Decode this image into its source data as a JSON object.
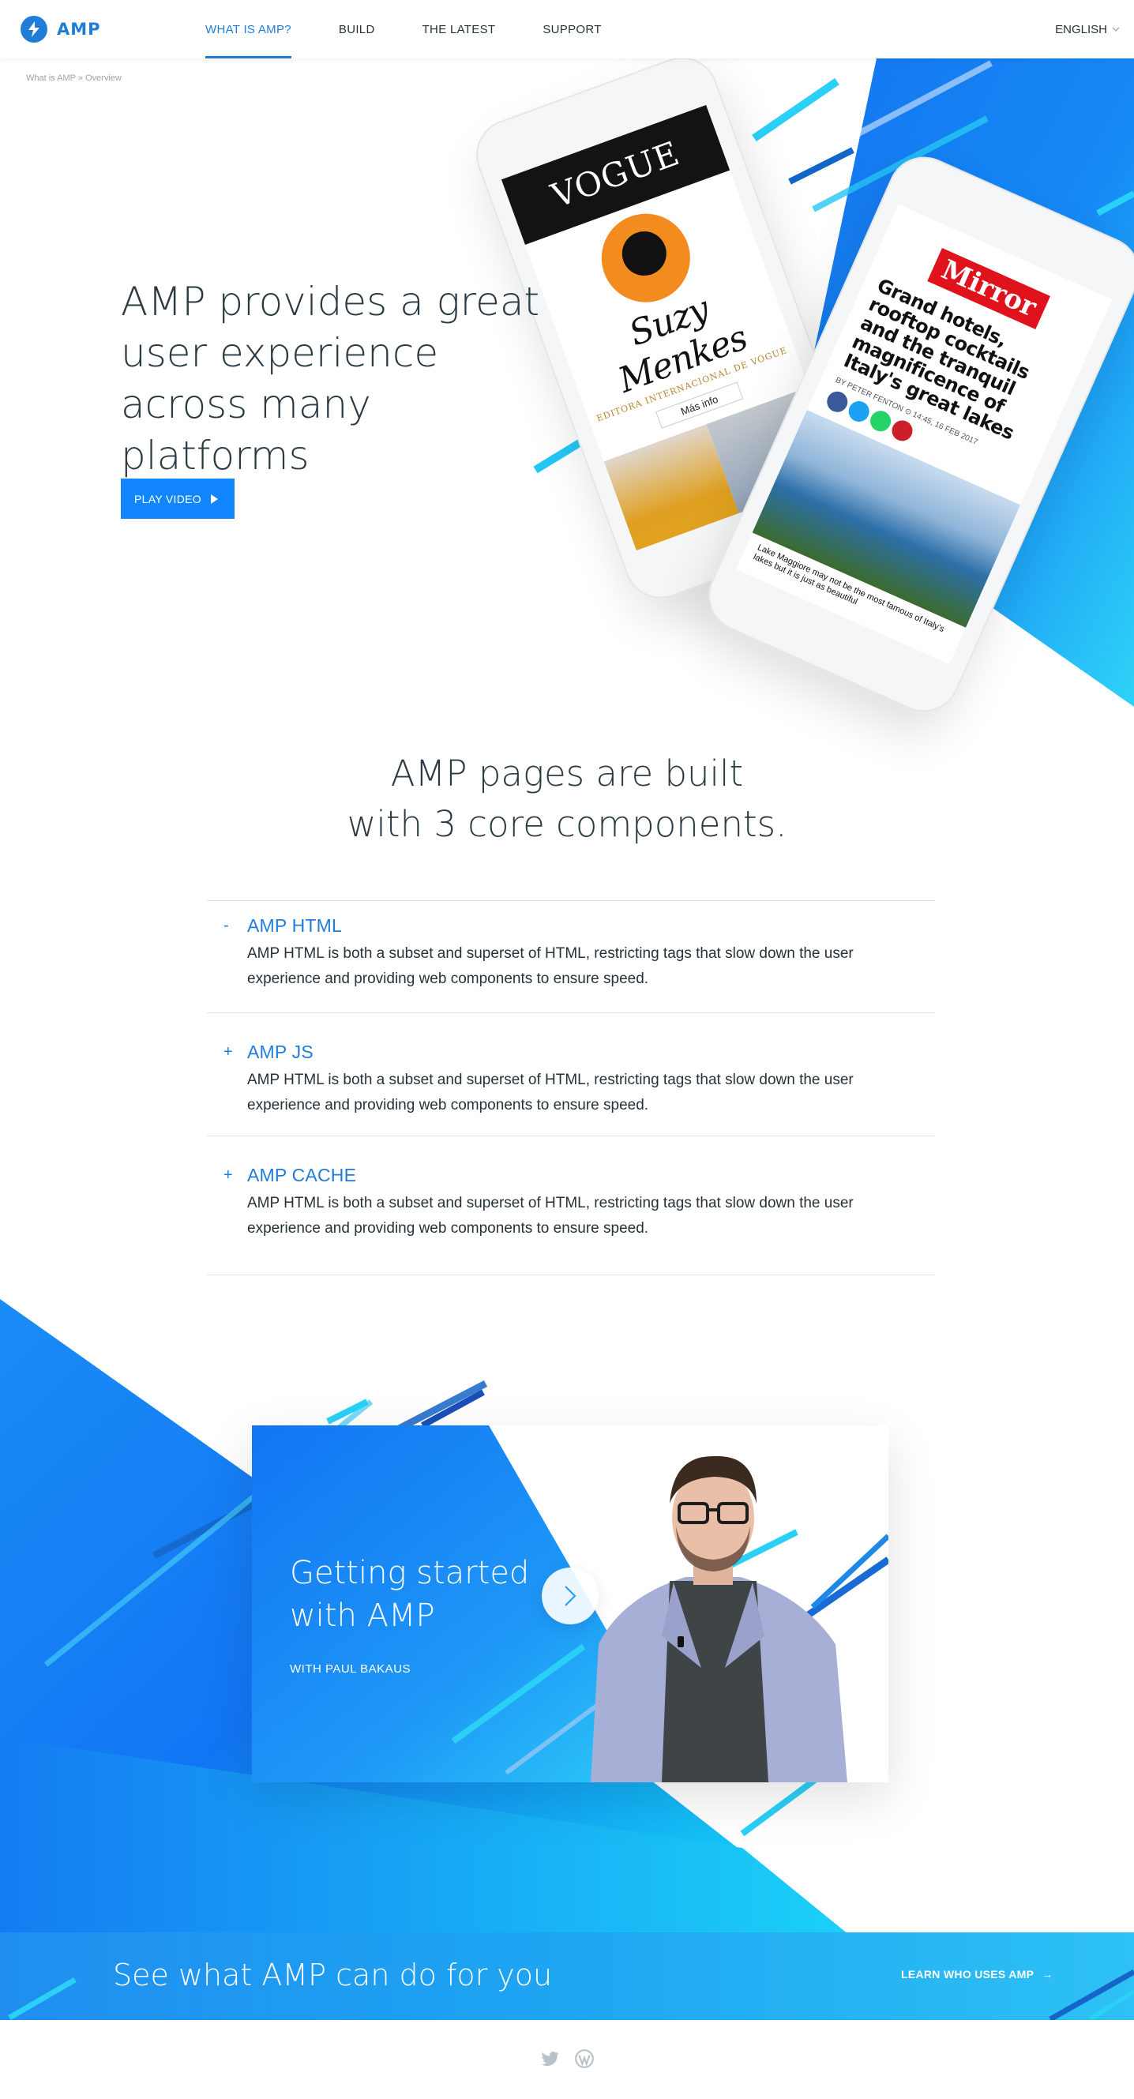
{
  "header": {
    "logo_text": "AMP",
    "nav": [
      {
        "label": "WHAT IS AMP?",
        "active": true
      },
      {
        "label": "BUILD",
        "active": false
      },
      {
        "label": "THE LATEST",
        "active": false
      },
      {
        "label": "SUPPORT",
        "active": false
      }
    ],
    "language": "ENGLISH"
  },
  "breadcrumb": "What is AMP » Overview",
  "hero": {
    "title": "AMP provides a great user experience across many platforms",
    "play_button": "PLAY VIDEO",
    "phone_vogue": {
      "masthead": "VOGUE",
      "name": "Suzy Menkes",
      "subtitle": "EDITORA INTERNACIONAL DE VOGUE",
      "more": "Más info"
    },
    "phone_mirror": {
      "masthead": "Mirror",
      "headline": "Grand hotels, rooftop cocktails and the tranquil magnificence of Italy's great lakes",
      "byline": "BY PETER FENTON  ⊙ 14:45, 16 FEB 2017",
      "caption": "Lake Maggiore may not be the most famous of Italy's lakes but it is just as beautiful"
    }
  },
  "components": {
    "title_line1": "AMP pages are built",
    "title_line2": "with 3 core components.",
    "items": [
      {
        "sign": "-",
        "label": "AMP HTML",
        "body": "AMP HTML is both a subset and superset of HTML, restricting tags that slow down the user experience and providing web components to ensure speed."
      },
      {
        "sign": "+",
        "label": "AMP JS",
        "body": "AMP HTML is both a subset and superset of HTML, restricting tags that slow down the user experience and providing web components to ensure speed."
      },
      {
        "sign": "+",
        "label": "AMP CACHE",
        "body": "AMP HTML is both a subset and superset of HTML, restricting tags that slow down the user experience and providing web components to ensure speed."
      }
    ]
  },
  "video": {
    "title": "Getting started with AMP",
    "subtitle": "WITH PAUL BAKAUS"
  },
  "cta": {
    "text": "See what AMP can do for you",
    "link": "LEARN WHO USES AMP",
    "arrow": "→"
  },
  "footer": {
    "icons": [
      "twitter-icon",
      "wordpress-icon"
    ]
  },
  "colors": {
    "brand_blue": "#1f7dd8",
    "button_blue": "#1286ff",
    "cyan": "#2dd0f5"
  }
}
